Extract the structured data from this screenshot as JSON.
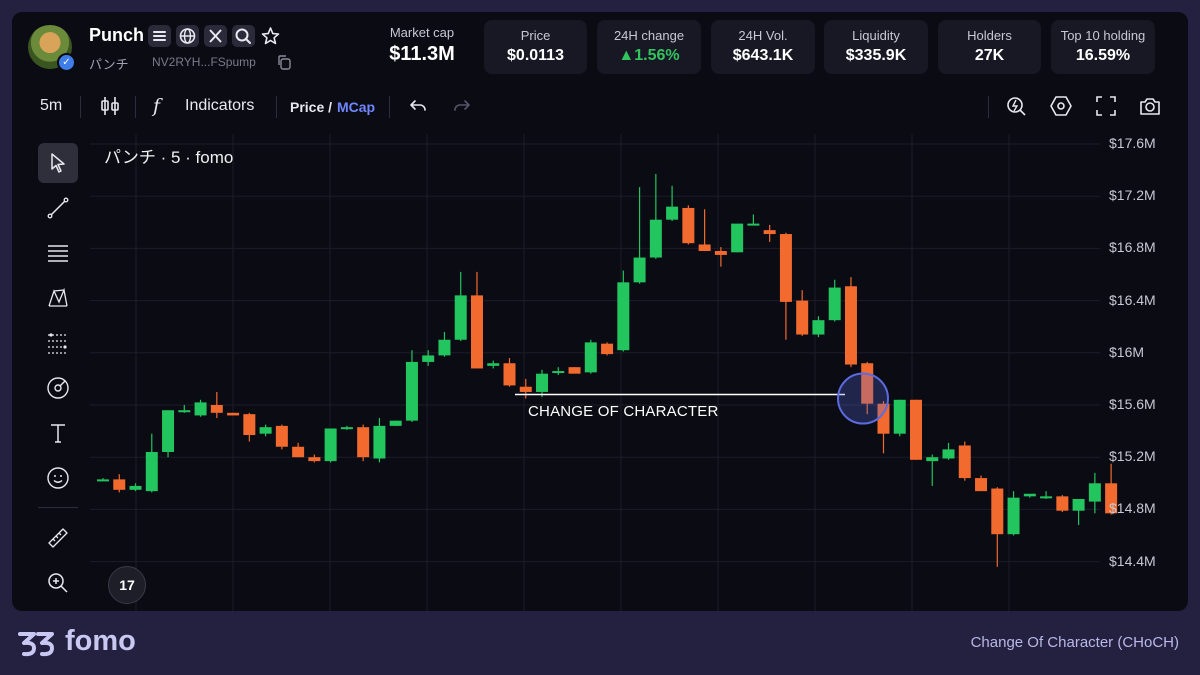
{
  "token": {
    "name": "Punch",
    "jp_name": "パンチ",
    "address": "NV2RYH...FSpump",
    "verified_badge": "✓"
  },
  "header_icons": [
    "list-icon",
    "globe-icon",
    "x-icon",
    "search-icon",
    "star-icon"
  ],
  "market_cap": {
    "label": "Market cap",
    "value": "$11.3M"
  },
  "stats": [
    {
      "label": "Price",
      "value": "$0.0113",
      "trend": ""
    },
    {
      "label": "24H change",
      "value": "▲1.56%",
      "trend": "up"
    },
    {
      "label": "24H Vol.",
      "value": "$643.1K",
      "trend": ""
    },
    {
      "label": "Liquidity",
      "value": "$335.9K",
      "trend": ""
    },
    {
      "label": "Holders",
      "value": "27K",
      "trend": ""
    },
    {
      "label": "Top 10 holding",
      "value": "16.59%",
      "trend": ""
    }
  ],
  "toolbar": {
    "interval": "5m",
    "indicators_label": "Indicators",
    "fx_glyph": "f",
    "price_label": "Price /",
    "mcap_label": "MCap",
    "right_icons": [
      "zap-search-icon",
      "settings-hex-icon",
      "fullscreen-icon",
      "camera-icon"
    ]
  },
  "tools": [
    "cursor-icon",
    "trendline-icon",
    "horizontal-lines-icon",
    "pattern-icon",
    "fib-icon",
    "brush-icon",
    "text-icon",
    "emoji-icon",
    "ruler-icon",
    "zoom-in-icon"
  ],
  "chart": {
    "title": "パンチ · 5 · fomo",
    "annotation": "CHANGE OF CHARACTER",
    "tv_logo": "17",
    "colors": {
      "up": "#22c55e",
      "down": "#f26a2e",
      "grid": "#1d1d2a",
      "annotation_line": "#ffffff",
      "circle": "#5b6be0"
    }
  },
  "chart_data": {
    "type": "candlestick",
    "unit": "market cap USD (millions)",
    "yticks": [
      "$17.6M",
      "$17.2M",
      "$16.8M",
      "$16.4M",
      "$16M",
      "$15.6M",
      "$15.2M",
      "$14.8M",
      "$14.4M"
    ],
    "ytick_values": [
      17.6,
      17.2,
      16.8,
      16.4,
      16.0,
      15.6,
      15.2,
      14.8,
      14.4
    ],
    "ylim": [
      14.1,
      17.7
    ],
    "candles": [
      {
        "o": 15.03,
        "h": 15.04,
        "l": 15.02,
        "c": 15.03
      },
      {
        "o": 15.03,
        "h": 15.07,
        "l": 14.93,
        "c": 14.95
      },
      {
        "o": 14.95,
        "h": 15.0,
        "l": 14.94,
        "c": 14.98
      },
      {
        "o": 14.94,
        "h": 15.38,
        "l": 14.93,
        "c": 15.24
      },
      {
        "o": 15.24,
        "h": 15.55,
        "l": 15.2,
        "c": 15.56
      },
      {
        "o": 15.56,
        "h": 15.6,
        "l": 15.54,
        "c": 15.56
      },
      {
        "o": 15.52,
        "h": 15.64,
        "l": 15.51,
        "c": 15.62
      },
      {
        "o": 15.6,
        "h": 15.7,
        "l": 15.5,
        "c": 15.54
      },
      {
        "o": 15.54,
        "h": 15.54,
        "l": 15.52,
        "c": 15.52
      },
      {
        "o": 15.53,
        "h": 15.54,
        "l": 15.32,
        "c": 15.37
      },
      {
        "o": 15.38,
        "h": 15.45,
        "l": 15.36,
        "c": 15.43
      },
      {
        "o": 15.44,
        "h": 15.45,
        "l": 15.26,
        "c": 15.28
      },
      {
        "o": 15.28,
        "h": 15.31,
        "l": 15.2,
        "c": 15.2
      },
      {
        "o": 15.2,
        "h": 15.22,
        "l": 15.16,
        "c": 15.17
      },
      {
        "o": 15.17,
        "h": 15.42,
        "l": 15.16,
        "c": 15.42
      },
      {
        "o": 15.42,
        "h": 15.44,
        "l": 15.41,
        "c": 15.43
      },
      {
        "o": 15.43,
        "h": 15.45,
        "l": 15.17,
        "c": 15.2
      },
      {
        "o": 15.19,
        "h": 15.5,
        "l": 15.16,
        "c": 15.44
      },
      {
        "o": 15.44,
        "h": 15.48,
        "l": 15.44,
        "c": 15.48
      },
      {
        "o": 15.48,
        "h": 16.02,
        "l": 15.47,
        "c": 15.93
      },
      {
        "o": 15.93,
        "h": 16.02,
        "l": 15.9,
        "c": 15.98
      },
      {
        "o": 15.98,
        "h": 16.16,
        "l": 15.97,
        "c": 16.1
      },
      {
        "o": 16.1,
        "h": 16.62,
        "l": 16.09,
        "c": 16.44
      },
      {
        "o": 16.44,
        "h": 16.62,
        "l": 15.88,
        "c": 15.88
      },
      {
        "o": 15.9,
        "h": 15.94,
        "l": 15.88,
        "c": 15.92
      },
      {
        "o": 15.92,
        "h": 15.96,
        "l": 15.74,
        "c": 15.75
      },
      {
        "o": 15.74,
        "h": 15.8,
        "l": 15.65,
        "c": 15.7
      },
      {
        "o": 15.7,
        "h": 15.87,
        "l": 15.66,
        "c": 15.84
      },
      {
        "o": 15.86,
        "h": 15.89,
        "l": 15.83,
        "c": 15.86
      },
      {
        "o": 15.89,
        "h": 15.89,
        "l": 15.85,
        "c": 15.84
      },
      {
        "o": 15.85,
        "h": 16.1,
        "l": 15.84,
        "c": 16.08
      },
      {
        "o": 16.07,
        "h": 16.08,
        "l": 15.98,
        "c": 15.99
      },
      {
        "o": 16.02,
        "h": 16.63,
        "l": 16.01,
        "c": 16.54
      },
      {
        "o": 16.54,
        "h": 17.27,
        "l": 16.53,
        "c": 16.73
      },
      {
        "o": 16.73,
        "h": 17.37,
        "l": 16.72,
        "c": 17.02
      },
      {
        "o": 17.02,
        "h": 17.28,
        "l": 17.01,
        "c": 17.12
      },
      {
        "o": 17.11,
        "h": 17.13,
        "l": 16.83,
        "c": 16.84
      },
      {
        "o": 16.83,
        "h": 17.1,
        "l": 16.78,
        "c": 16.78
      },
      {
        "o": 16.78,
        "h": 16.81,
        "l": 16.66,
        "c": 16.75
      },
      {
        "o": 16.77,
        "h": 16.98,
        "l": 16.77,
        "c": 16.99
      },
      {
        "o": 16.99,
        "h": 17.06,
        "l": 16.98,
        "c": 16.99
      },
      {
        "o": 16.94,
        "h": 16.98,
        "l": 16.85,
        "c": 16.91
      },
      {
        "o": 16.91,
        "h": 16.92,
        "l": 16.1,
        "c": 16.39
      },
      {
        "o": 16.4,
        "h": 16.48,
        "l": 16.13,
        "c": 16.14
      },
      {
        "o": 16.14,
        "h": 16.28,
        "l": 16.12,
        "c": 16.25
      },
      {
        "o": 16.25,
        "h": 16.56,
        "l": 16.24,
        "c": 16.5
      },
      {
        "o": 16.51,
        "h": 16.58,
        "l": 15.89,
        "c": 15.91
      },
      {
        "o": 15.92,
        "h": 15.93,
        "l": 15.53,
        "c": 15.61
      },
      {
        "o": 15.61,
        "h": 15.63,
        "l": 15.23,
        "c": 15.38
      },
      {
        "o": 15.38,
        "h": 15.64,
        "l": 15.36,
        "c": 15.64
      },
      {
        "o": 15.64,
        "h": 15.64,
        "l": 15.18,
        "c": 15.18
      },
      {
        "o": 15.17,
        "h": 15.22,
        "l": 14.98,
        "c": 15.2
      },
      {
        "o": 15.19,
        "h": 15.31,
        "l": 15.18,
        "c": 15.26
      },
      {
        "o": 15.29,
        "h": 15.32,
        "l": 15.02,
        "c": 15.04
      },
      {
        "o": 15.04,
        "h": 15.06,
        "l": 14.94,
        "c": 14.94
      },
      {
        "o": 14.96,
        "h": 14.97,
        "l": 14.36,
        "c": 14.61
      },
      {
        "o": 14.61,
        "h": 14.94,
        "l": 14.6,
        "c": 14.89
      },
      {
        "o": 14.9,
        "h": 14.91,
        "l": 14.89,
        "c": 14.92
      },
      {
        "o": 14.9,
        "h": 14.94,
        "l": 14.88,
        "c": 14.9
      },
      {
        "o": 14.9,
        "h": 14.91,
        "l": 14.78,
        "c": 14.79
      },
      {
        "o": 14.79,
        "h": 14.86,
        "l": 14.68,
        "c": 14.88
      },
      {
        "o": 14.86,
        "h": 15.08,
        "l": 14.77,
        "c": 15.0
      },
      {
        "o": 15.0,
        "h": 15.15,
        "l": 14.76,
        "c": 14.77
      }
    ]
  },
  "footer": {
    "brand": "fomo",
    "caption": "Change Of Character (CHoCH)"
  }
}
